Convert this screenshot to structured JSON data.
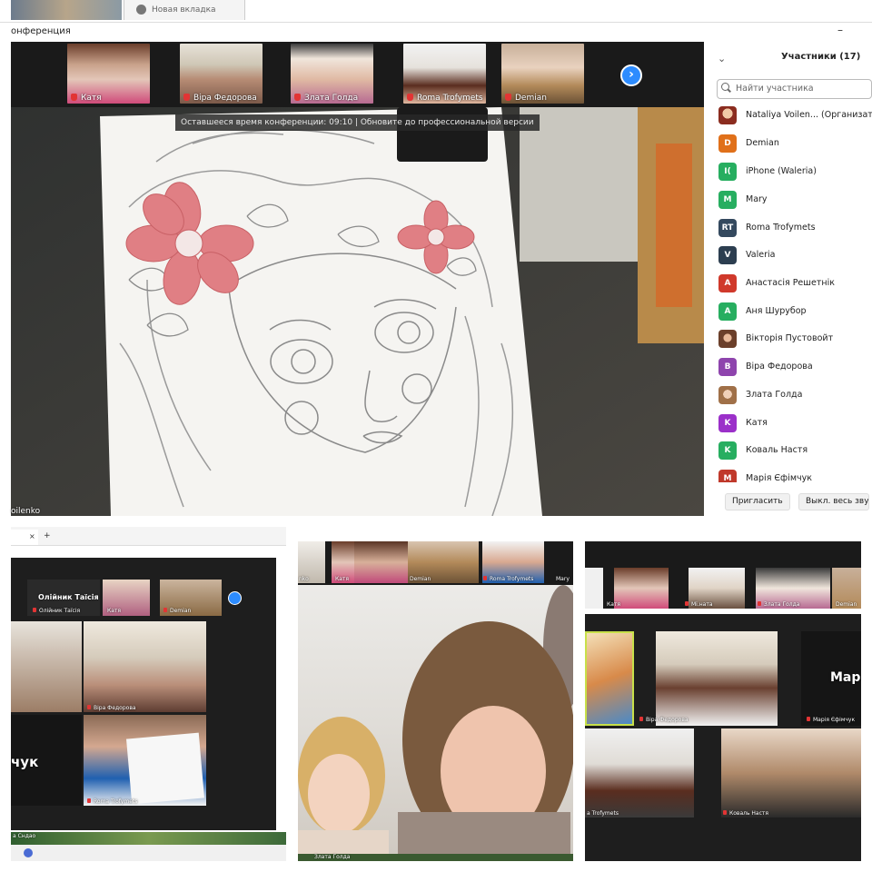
{
  "browser": {
    "tab_title": "Новая вкладка"
  },
  "window": {
    "title": "онференция",
    "minimize": "–"
  },
  "thumbnails": [
    {
      "name": "Катя"
    },
    {
      "name": "Віра Федорова"
    },
    {
      "name": "Злата Голда"
    },
    {
      "name": "Roma Trofymets"
    },
    {
      "name": "Demian"
    }
  ],
  "notice": "Оставшееся время конференции: 09:10 | Обновите до профессиональной версии",
  "main_video_name": "oilenko",
  "participants": {
    "title": "Участники (17)",
    "search_placeholder": "Найти участника",
    "list": [
      {
        "initials": "",
        "name": "Nataliya Voilen... (Организато",
        "color": "#b03a2e",
        "photo": true
      },
      {
        "initials": "D",
        "name": "Demian",
        "color": "#e0701a"
      },
      {
        "initials": "I(",
        "name": "iPhone (Waleria)",
        "color": "#27ae60"
      },
      {
        "initials": "M",
        "name": "Mary",
        "color": "#27ae60"
      },
      {
        "initials": "RT",
        "name": "Roma Trofymets",
        "color": "#34495e"
      },
      {
        "initials": "V",
        "name": "Valeria",
        "color": "#2c3e50"
      },
      {
        "initials": "A",
        "name": "Анастасія Решетнік",
        "color": "#d0392b"
      },
      {
        "initials": "A",
        "name": "Аня Шурубор",
        "color": "#27ae60"
      },
      {
        "initials": "",
        "name": "Вікторія Пустовойт",
        "color": "#8e5b3a",
        "photo": true
      },
      {
        "initials": "B",
        "name": "Віра Федорова",
        "color": "#8e44ad"
      },
      {
        "initials": "",
        "name": "Злата Голда",
        "color": "#b08050",
        "photo": true
      },
      {
        "initials": "K",
        "name": "Катя",
        "color": "#9b30c9"
      },
      {
        "initials": "K",
        "name": "Коваль Настя",
        "color": "#27ae60"
      },
      {
        "initials": "M",
        "name": "Марія Єфімчук",
        "color": "#c0392b"
      }
    ],
    "invite_label": "Пригласить",
    "mute_all_label": "Выкл. весь звук"
  },
  "bottom_left": {
    "tab_close": "×",
    "tab_add": "+",
    "name_tile": "Олійник Таїсія",
    "name_tile_label": "Олійник Таїсія",
    "thumb_labels": [
      "Катя",
      "Demian"
    ],
    "big_name": "чук",
    "vira_label": "Віра Федорова",
    "roma_label": "Roma Trofymets",
    "footer_name": "а Сндао"
  },
  "bottom_middle": {
    "thumb_labels": [
      "nko",
      "Катя",
      "Demian",
      "Roma Trofymets",
      "Mary"
    ],
    "footer_name": "Злата Голда"
  },
  "bottom_right": {
    "thumb_labels": [
      "Катя",
      "Mi.ната",
      "Злата Голда",
      "Demian"
    ],
    "big_name": "Мар",
    "vira_label": "Віра Федорова",
    "mariia_label": "Марія Єфімчук",
    "roma_label": "a Trofymets",
    "koval_label": "Коваль Настя"
  }
}
